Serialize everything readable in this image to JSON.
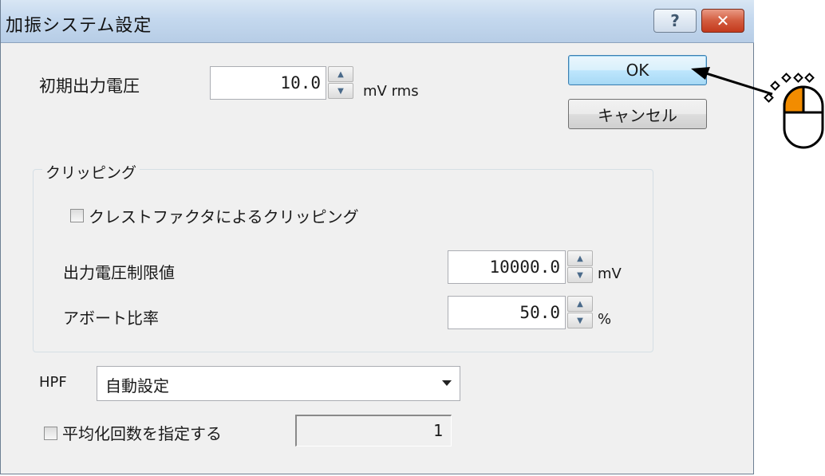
{
  "window": {
    "title": "加振システム設定",
    "help_label": "?",
    "close_label": "✕"
  },
  "initial_voltage": {
    "label": "初期出力電圧",
    "value": "10.0",
    "unit": "mV rms"
  },
  "buttons": {
    "ok": "OK",
    "cancel": "キャンセル"
  },
  "clipping": {
    "group_title": "クリッピング",
    "crest_factor_label": "クレストファクタによるクリッピング",
    "crest_factor_checked": false,
    "voltage_limit": {
      "label": "出力電圧制限値",
      "value": "10000.0",
      "unit": "mV"
    },
    "abort_ratio": {
      "label": "アボート比率",
      "value": "50.0",
      "unit": "%"
    }
  },
  "hpf": {
    "label": "HPF",
    "selected": "自動設定"
  },
  "averaging": {
    "label": "平均化回数を指定する",
    "checked": false,
    "value": "1"
  },
  "icons": {
    "mouse": "mouse-left-click-icon",
    "arrow": "pointer-arrow-icon"
  },
  "colors": {
    "ok_border": "#3c7fb1",
    "mouse_button_highlight": "#f28c00",
    "titlebar": "#c4d8ee"
  }
}
